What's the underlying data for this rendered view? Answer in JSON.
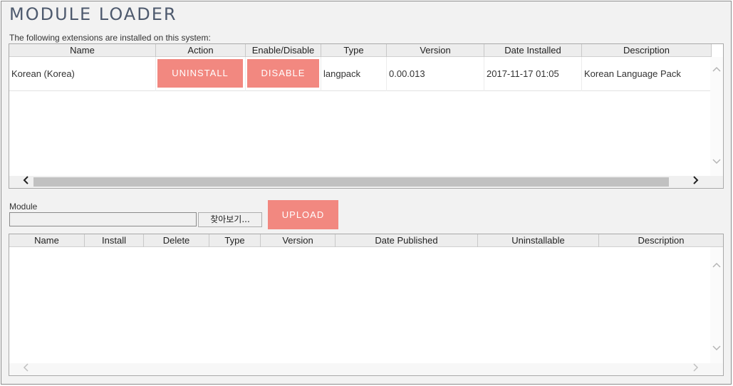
{
  "page": {
    "title": "MODULE LOADER",
    "installed_caption": "The following extensions are installed on this system:"
  },
  "installed_table": {
    "columns": [
      "Name",
      "Action",
      "Enable/Disable",
      "Type",
      "Version",
      "Date Installed",
      "Description"
    ],
    "rows": [
      {
        "name": "Korean (Korea)",
        "action_label": "UNINSTALL",
        "toggle_label": "DISABLE",
        "type": "langpack",
        "version": "0.00.013",
        "date_installed": "2017-11-17 01:05",
        "description": "Korean Language Pack"
      }
    ]
  },
  "upload": {
    "module_label": "Module",
    "file_value": "",
    "browse_label": "찾아보기...",
    "upload_label": "UPLOAD"
  },
  "available_table": {
    "columns": [
      "Name",
      "Install",
      "Delete",
      "Type",
      "Version",
      "Date Published",
      "Uninstallable",
      "Description"
    ],
    "rows": []
  },
  "colors": {
    "accent": "#f28880",
    "title": "#4e5a6e",
    "panel": "#f2f2f2"
  },
  "icons": {
    "scroll_up": "chevron-up-icon",
    "scroll_down": "chevron-down-icon",
    "scroll_left": "chevron-left-icon",
    "scroll_right": "chevron-right-icon"
  }
}
